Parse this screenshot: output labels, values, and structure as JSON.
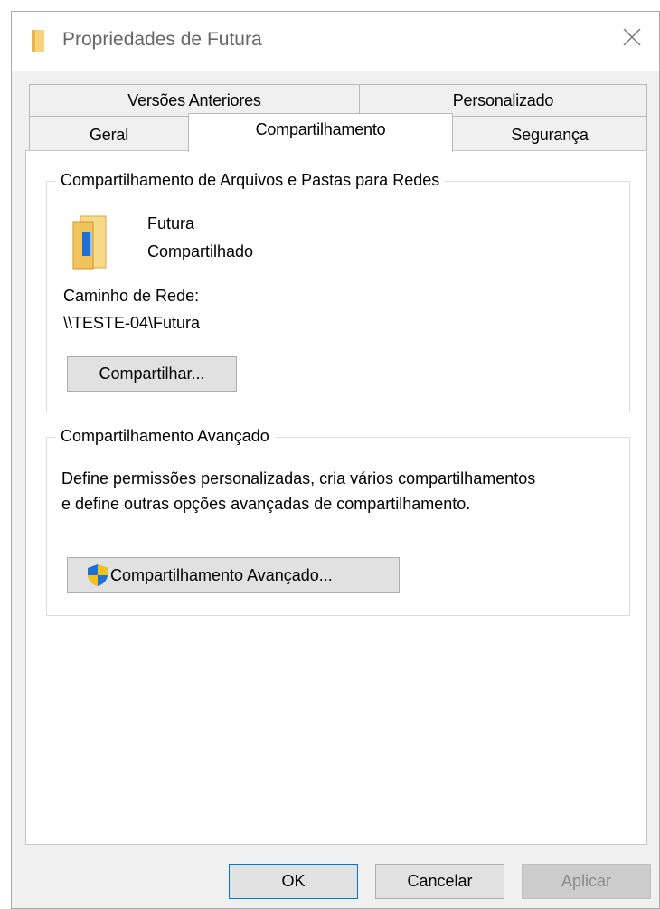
{
  "window": {
    "title": "Propriedades de Futura"
  },
  "tabs": {
    "row_back": [
      {
        "label": "Versões Anteriores"
      },
      {
        "label": "Personalizado"
      }
    ],
    "row_front": [
      {
        "label": "Geral"
      },
      {
        "label": "Compartilhamento",
        "selected": true
      },
      {
        "label": "Segurança"
      }
    ]
  },
  "network_sharing": {
    "group_title": "Compartilhamento de Arquivos e Pastas para Redes",
    "folder_name": "Futura",
    "folder_status": "Compartilhado",
    "path_label": "Caminho de Rede:",
    "path_value": "\\\\TESTE-04\\Futura",
    "share_button": "Compartilhar..."
  },
  "advanced_sharing": {
    "group_title": "Compartilhamento Avançado",
    "description_line1": "Define permissões personalizadas, cria vários compartilhamentos",
    "description_line2": "e define outras opções avançadas de compartilhamento.",
    "button": "Compartilhamento Avançado..."
  },
  "footer": {
    "ok": "OK",
    "cancel": "Cancelar",
    "apply": "Aplicar"
  },
  "colors": {
    "folder": "#f2c35a",
    "shield_blue": "#1f6fd6",
    "shield_yellow": "#f2c21a",
    "accent": "#0078d7"
  },
  "icons": {
    "title": "folder-icon",
    "close": "close-icon",
    "shared_folder": "shared-folder-icon",
    "uac": "uac-shield-icon"
  }
}
